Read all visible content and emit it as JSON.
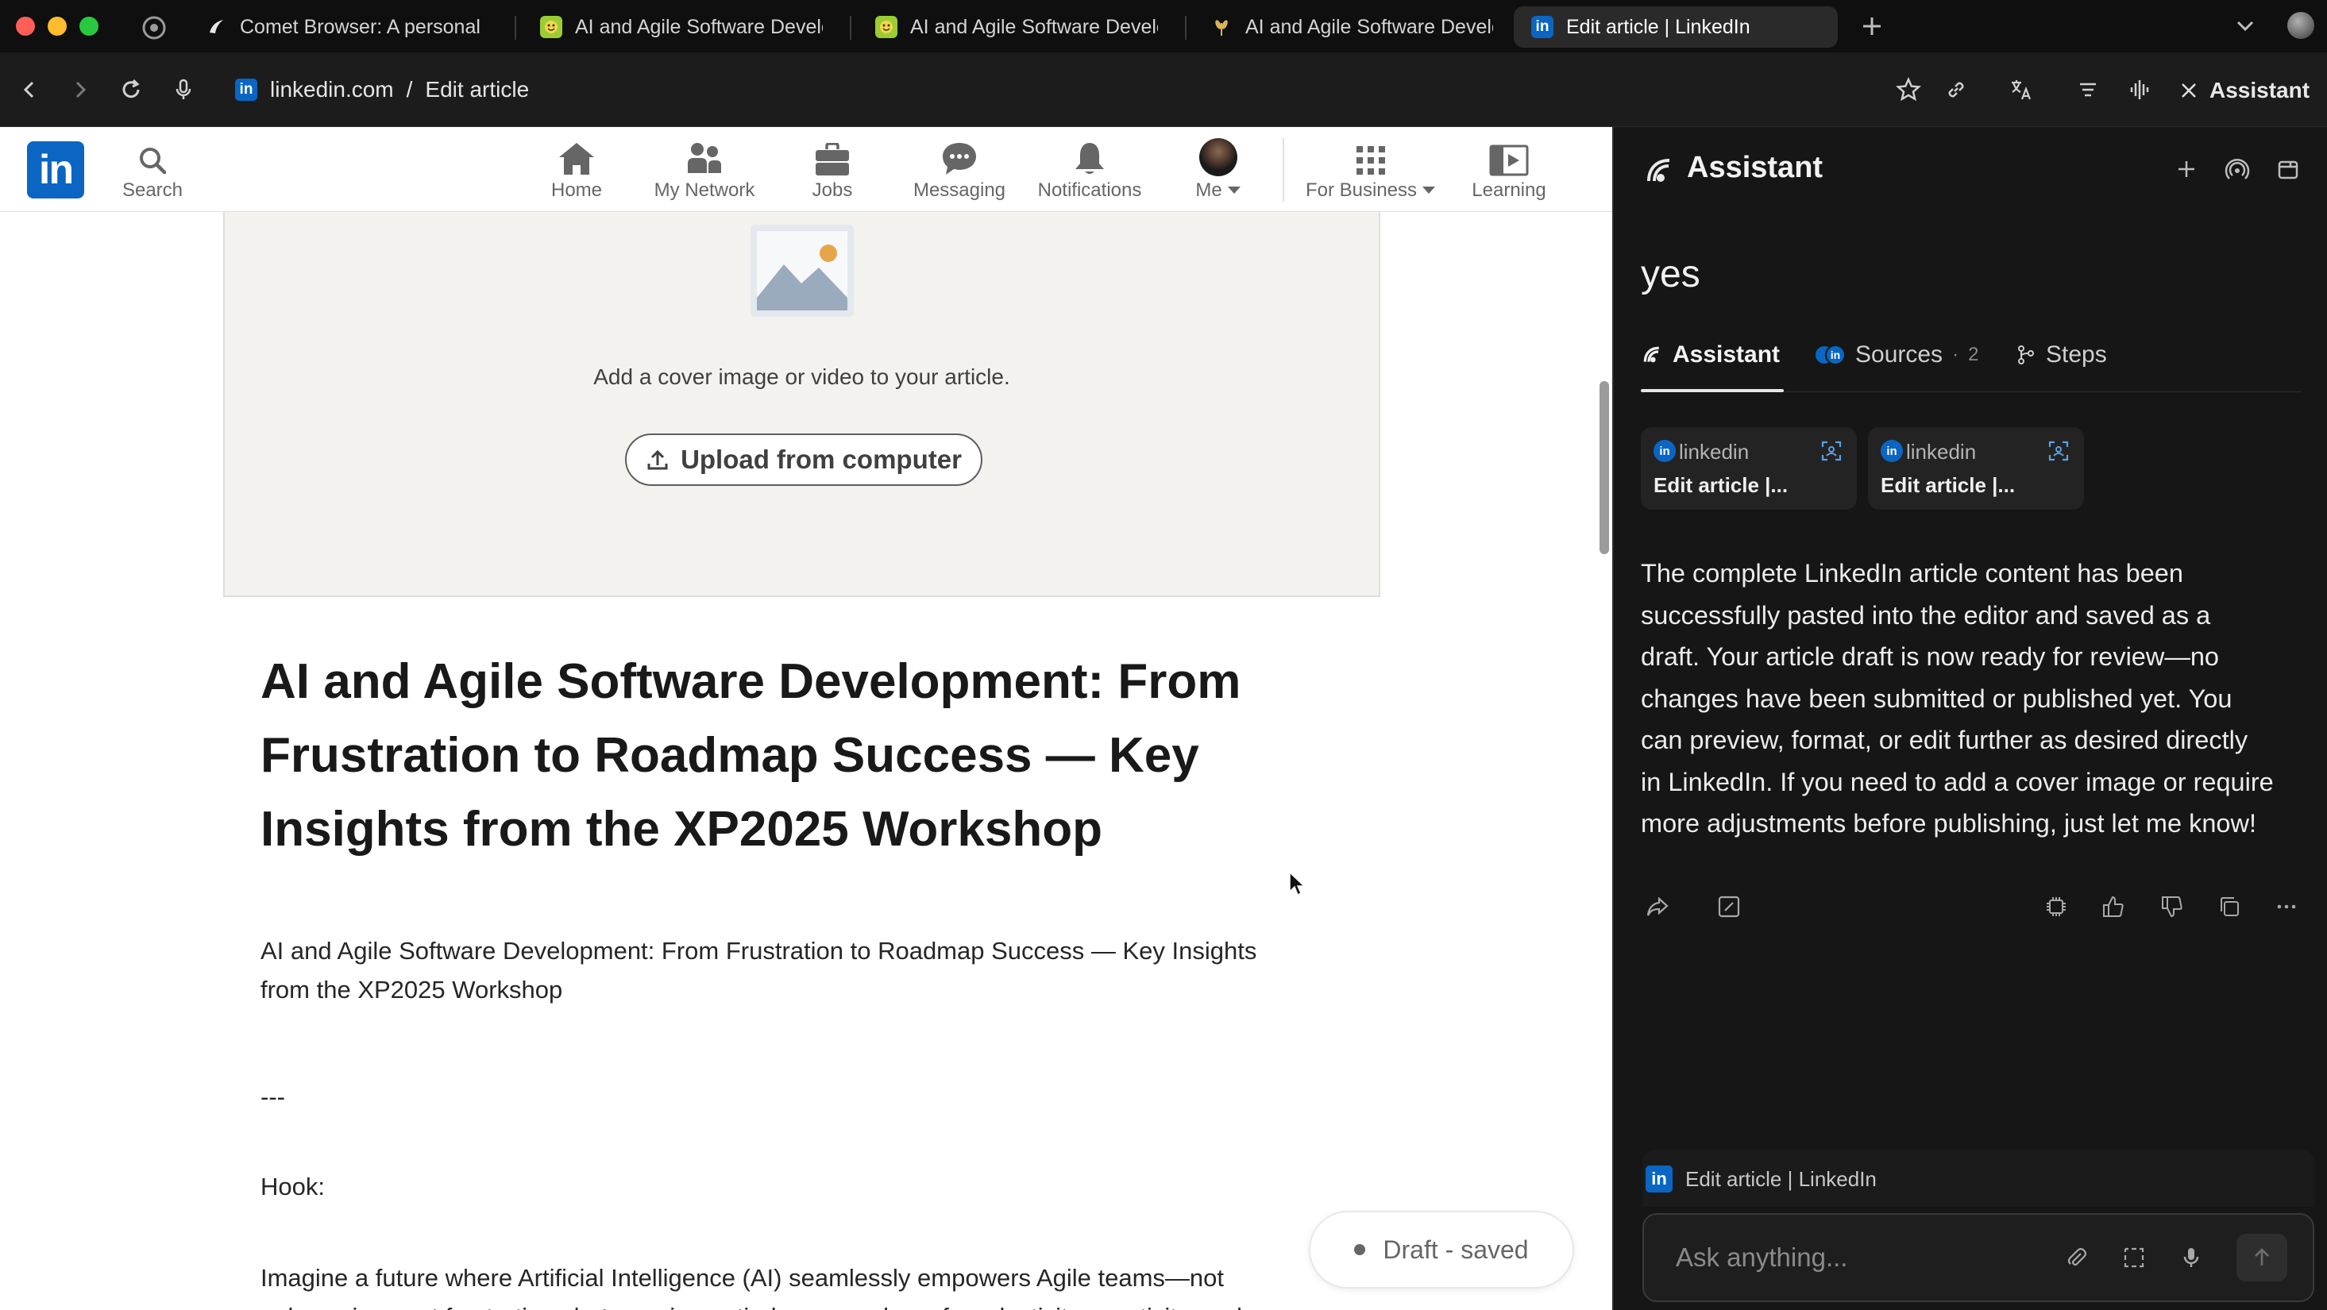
{
  "browser": {
    "tabs": [
      {
        "title": "Comet Browser: A personal",
        "icon": "comet-icon"
      },
      {
        "title": "AI and Agile Software Development",
        "icon": "agile-favicon"
      },
      {
        "title": "AI and Agile Software Development",
        "icon": "agile-favicon"
      },
      {
        "title": "AI and Agile Software Development",
        "icon": "wheat-favicon"
      },
      {
        "title": "Edit article | LinkedIn",
        "icon": "linkedin-favicon",
        "active": true
      }
    ],
    "url_domain": "linkedin.com",
    "url_separator": "/",
    "url_path": "Edit article",
    "assistant_toggle_label": "Assistant"
  },
  "linkedin": {
    "logo_text": "in",
    "brand_color": "#0a66c2",
    "search_label": "Search",
    "nav": {
      "home": "Home",
      "network": "My Network",
      "jobs": "Jobs",
      "messaging": "Messaging",
      "notifications": "Notifications",
      "me": "Me",
      "business": "For Business",
      "learning": "Learning"
    }
  },
  "article": {
    "cover_prompt": "Add a cover image or video to your article.",
    "upload_label": "Upload from computer",
    "title_lines": [
      "AI and Agile Software Development: From",
      "Frustration to Roadmap Success — Key",
      "Insights from the XP2025 Workshop"
    ],
    "subtitle_lines": [
      "AI and Agile Software Development: From Frustration to Roadmap Success — Key Insights",
      "from the XP2025 Workshop"
    ],
    "divider": "---",
    "hook_label": "Hook:",
    "hook_text_lines": [
      "Imagine a future where Artificial Intelligence (AI) seamlessly empowers Agile teams—not",
      "only easing past frustrations but opening entirely new realms of productivity, creativity, and"
    ],
    "draft_status": "Draft - saved"
  },
  "assistant": {
    "title": "Assistant",
    "query": "yes",
    "tabs": {
      "assistant": "Assistant",
      "sources": "Sources",
      "sources_separator": "·",
      "sources_count": "2",
      "steps": "Steps"
    },
    "sources": [
      {
        "site": "linkedin",
        "title": "Edit article |..."
      },
      {
        "site": "linkedin",
        "title": "Edit article |..."
      }
    ],
    "answer_lines": [
      "The complete LinkedIn article content has been",
      "successfully pasted into the editor and saved as a",
      "draft. Your article draft is now ready for review—no",
      "changes have been submitted or published yet. You",
      "can preview, format, or edit further as desired directly",
      "in LinkedIn. If you need to add a cover image or require",
      "more adjustments before publishing, just let me know!"
    ],
    "context_label": "Edit article | LinkedIn",
    "ask_placeholder": "Ask anything..."
  }
}
